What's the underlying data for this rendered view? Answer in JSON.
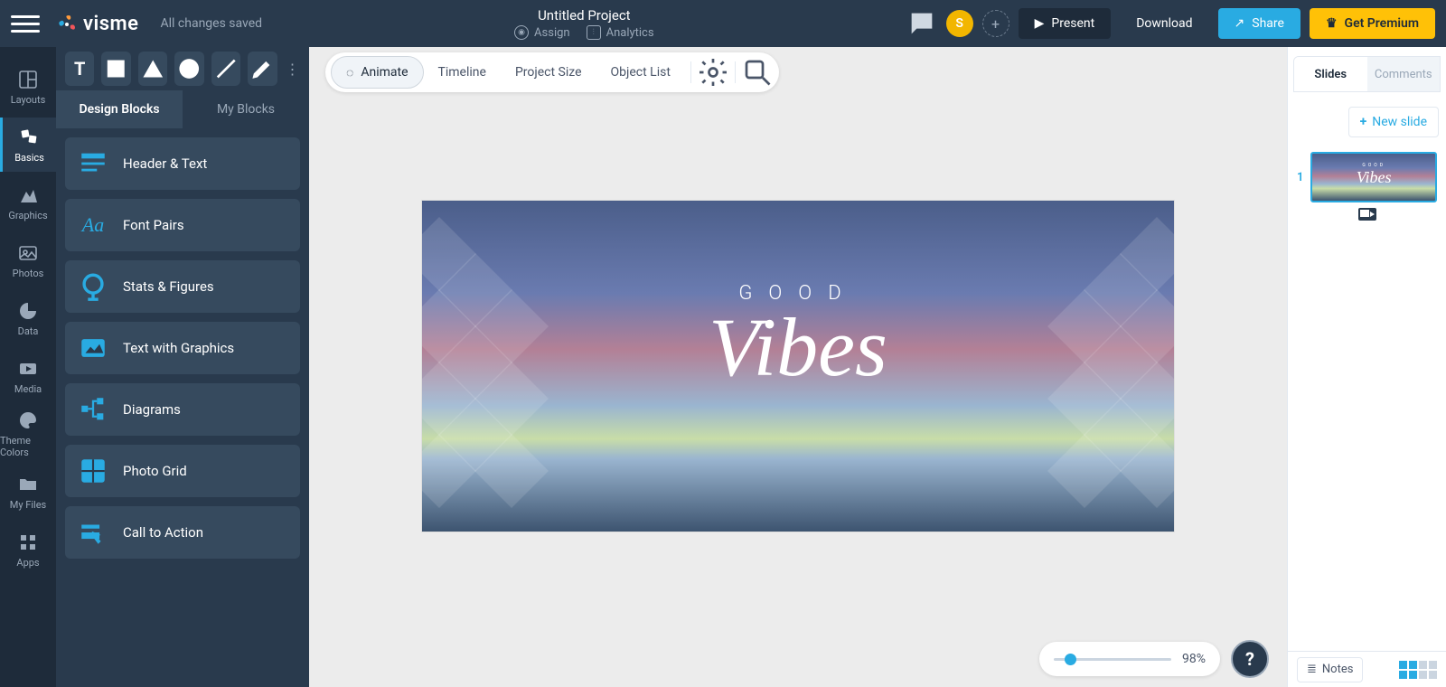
{
  "header": {
    "brand": "visme",
    "save_status": "All changes saved",
    "project_title": "Untitled Project",
    "assign_label": "Assign",
    "analytics_label": "Analytics",
    "avatar_initial": "S",
    "present_label": "Present",
    "download_label": "Download",
    "share_label": "Share",
    "premium_label": "Get Premium"
  },
  "rail": {
    "items": [
      {
        "label": "Layouts"
      },
      {
        "label": "Basics"
      },
      {
        "label": "Graphics"
      },
      {
        "label": "Photos"
      },
      {
        "label": "Data"
      },
      {
        "label": "Media"
      },
      {
        "label": "Theme Colors"
      },
      {
        "label": "My Files"
      },
      {
        "label": "Apps"
      }
    ]
  },
  "panel": {
    "tabs": {
      "design": "Design Blocks",
      "my": "My Blocks"
    },
    "blocks": [
      {
        "label": "Header & Text"
      },
      {
        "label": "Font Pairs"
      },
      {
        "label": "Stats & Figures"
      },
      {
        "label": "Text with Graphics"
      },
      {
        "label": "Diagrams"
      },
      {
        "label": "Photo Grid"
      },
      {
        "label": "Call to Action"
      }
    ]
  },
  "canvas_toolbar": {
    "animate": "Animate",
    "timeline": "Timeline",
    "project_size": "Project Size",
    "object_list": "Object List"
  },
  "slide": {
    "line1": "GOOD",
    "line2": "Vibes"
  },
  "zoom": {
    "value": "98%"
  },
  "right_panel": {
    "tabs": {
      "slides": "Slides",
      "comments": "Comments"
    },
    "new_slide": "New slide",
    "thumb_number": "1",
    "notes_label": "Notes"
  }
}
